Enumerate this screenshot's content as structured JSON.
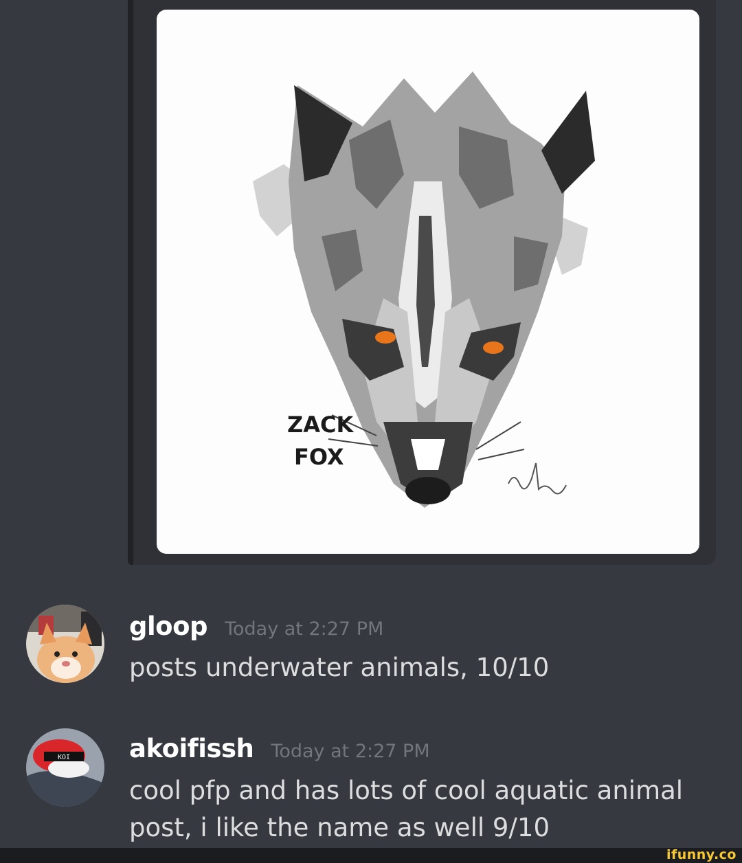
{
  "embed": {
    "image_alt": "Grayscale fox illustration with orange eyes",
    "image_text_line1": "ZACK",
    "image_text_line2": "FOX"
  },
  "messages": [
    {
      "username": "gloop",
      "timestamp": "Today at 2:27 PM",
      "text": "posts underwater animals, 10/10",
      "avatar_icon": "cat-avatar"
    },
    {
      "username": "akoifissh",
      "timestamp": "Today at 2:27 PM",
      "text": "cool pfp and has lots of cool aquatic animal post, i like the name as well 9/10",
      "avatar_icon": "koi-avatar",
      "avatar_label": "KOI"
    }
  ],
  "watermark": "ifunny.co",
  "colors": {
    "background": "#36393f",
    "embed_background": "#2f3136",
    "username": "#ffffff",
    "timestamp": "#72767d",
    "message_text": "#dcddde",
    "fox_eye": "#e8751a",
    "watermark": "#f7c832"
  }
}
